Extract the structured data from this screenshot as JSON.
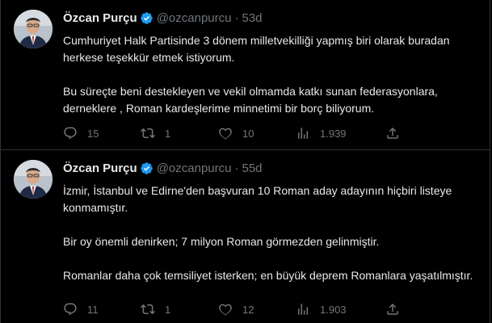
{
  "tweets": [
    {
      "author": {
        "name": "Özcan Purçu",
        "handle": "@ozcanpurcu",
        "time": "53d",
        "verified": true
      },
      "paragraphs": [
        "Cumhuriyet Halk Partisinde 3 dönem milletvekilliği yapmış biri olarak buradan herkese teşekkür etmek istiyorum.",
        "Bu süreçte beni destekleyen ve vekil olmamda katkı sunan federasyonlara, derneklere , Roman kardeşlerime minnetimi bir borç biliyorum."
      ],
      "stats": {
        "replies": "15",
        "retweets": "1",
        "likes": "10",
        "views": "1.939"
      }
    },
    {
      "author": {
        "name": "Özcan Purçu",
        "handle": "@ozcanpurcu",
        "time": "55d",
        "verified": true
      },
      "paragraphs": [
        "İzmir, İstanbul ve Edirne'den başvuran  10 Roman aday adayının hiçbiri listeye konmamıştır.",
        "Bir oy önemli denirken; 7 milyon Roman görmezden gelinmiştir.",
        "Romanlar daha çok temsiliyet isterken; en büyük deprem Romanlara yaşatılmıştır."
      ],
      "stats": {
        "replies": "11",
        "retweets": "1",
        "likes": "12",
        "views": "1.903"
      }
    }
  ],
  "separator": "·",
  "colors": {
    "background": "#000000",
    "text": "#e7e9ea",
    "muted": "#71767b",
    "verified": "#1d9bf0",
    "divider": "#2f3336"
  },
  "icons": {
    "reply": "reply-icon",
    "retweet": "retweet-icon",
    "like": "heart-icon",
    "views": "views-chart-icon",
    "share": "share-icon",
    "verified": "verified-badge-icon"
  }
}
